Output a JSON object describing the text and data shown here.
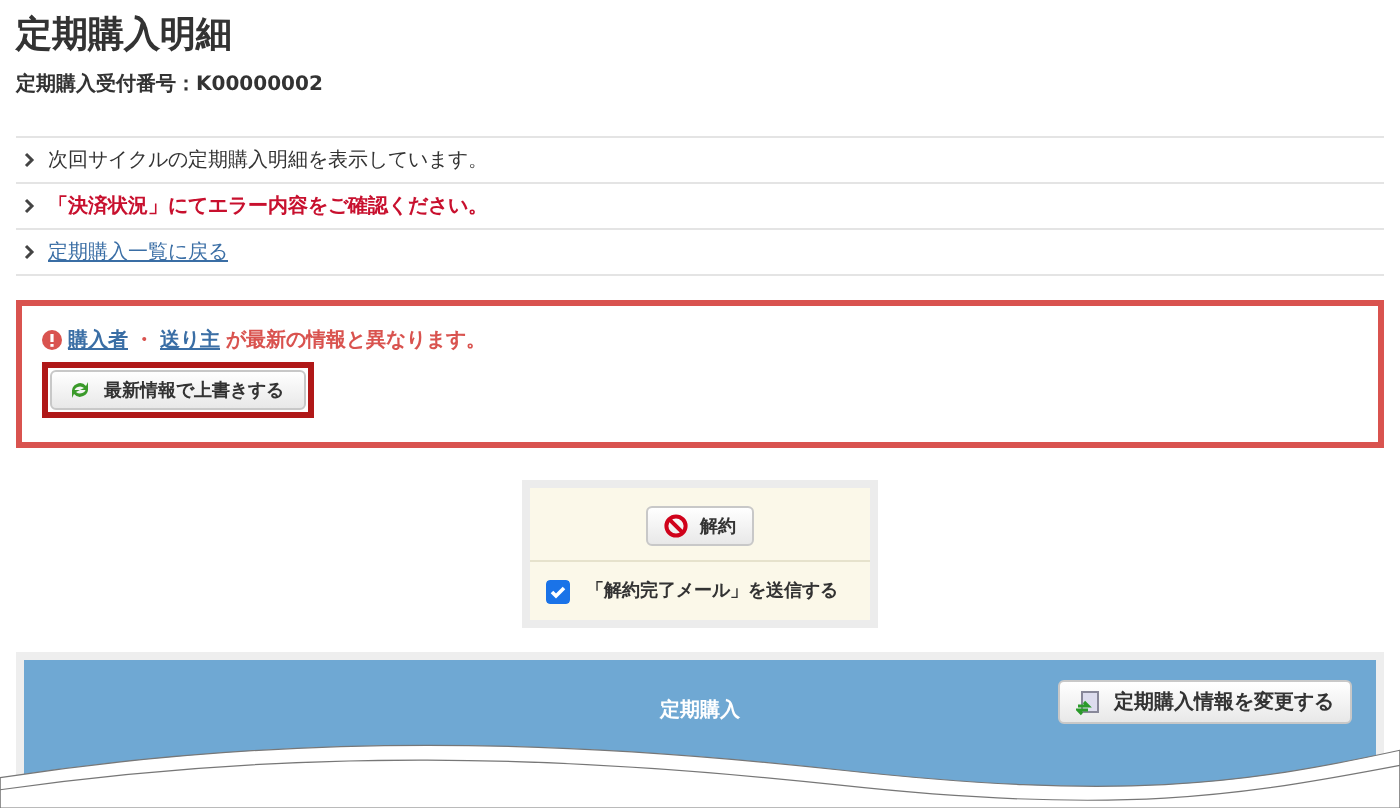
{
  "page": {
    "title": "定期購入明細",
    "order_number": "定期購入受付番号：K00000002"
  },
  "notices": [
    {
      "kind": "info",
      "text": "次回サイクルの定期購入明細を表示しています。"
    },
    {
      "kind": "error",
      "text": "「決済状況」にてエラー内容をご確認ください。"
    },
    {
      "kind": "link",
      "text": "定期購入一覧に戻る"
    }
  ],
  "warning": {
    "links": [
      "購入者",
      "送り主"
    ],
    "separator": "・",
    "message": "が最新の情報と異なります。",
    "button": "最新情報で上書きする"
  },
  "cancel_panel": {
    "button": "解約",
    "checkbox": {
      "label": "「解約完了メール」を送信する",
      "checked": true
    }
  },
  "section": {
    "title": "定期購入",
    "button": "定期購入情報を変更する"
  }
}
